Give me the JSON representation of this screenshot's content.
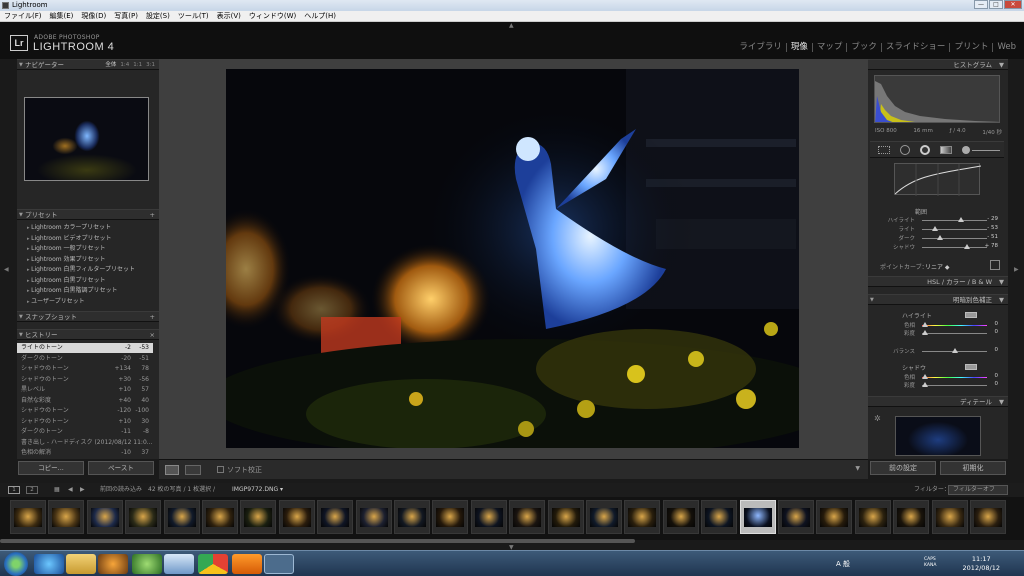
{
  "window": {
    "title": "Lightroom",
    "minimize": "—",
    "maximize": "□",
    "close": "✕"
  },
  "menu": [
    "ファイル(F)",
    "編集(E)",
    "現像(D)",
    "写真(P)",
    "設定(S)",
    "ツール(T)",
    "表示(V)",
    "ウィンドウ(W)",
    "ヘルプ(H)"
  ],
  "identity": {
    "logo": "Lr",
    "top": "ADOBE PHOTOSHOP",
    "name": "LIGHTROOM 4"
  },
  "modules": {
    "library": "ライブラリ",
    "develop": "現像",
    "map": "マップ",
    "book": "ブック",
    "slideshow": "スライドショー",
    "print": "プリント",
    "web": "Web",
    "active": "develop"
  },
  "navigator": {
    "title": "ナビゲーター",
    "opts": [
      "全体",
      "1:4",
      "1:1",
      "3:1"
    ]
  },
  "presets": {
    "title": "プリセット",
    "items": [
      "Lightroom カラープリセット",
      "Lightroom ビデオプリセット",
      "Lightroom 一般プリセット",
      "Lightroom 効果プリセット",
      "Lightroom 白黒フィルタープリセット",
      "Lightroom 白黒プリセット",
      "Lightroom 白黒階調プリセット",
      "ユーザープリセット"
    ]
  },
  "snapshots": {
    "title": "スナップショット"
  },
  "history": {
    "title": "ヒストリー",
    "close": "×",
    "rows": [
      {
        "name": "ライトのトーン",
        "a": "-2",
        "b": "-53"
      },
      {
        "name": "ダークのトーン",
        "a": "-20",
        "b": "-51"
      },
      {
        "name": "シャドウのトーン",
        "a": "+134",
        "b": "78"
      },
      {
        "name": "シャドウのトーン",
        "a": "+30",
        "b": "-56"
      },
      {
        "name": "黒レベル",
        "a": "+10",
        "b": "57"
      },
      {
        "name": "自然な彩度",
        "a": "+40",
        "b": "40"
      },
      {
        "name": "シャドウのトーン",
        "a": "-120",
        "b": "-100"
      },
      {
        "name": "シャドウのトーン",
        "a": "+10",
        "b": "30"
      },
      {
        "name": "ダークのトーン",
        "a": "-11",
        "b": "-8"
      },
      {
        "name": "書き出し - ハードディスク (2012/08/12 11:0...",
        "a": "",
        "b": ""
      },
      {
        "name": "色相の解消",
        "a": "-10",
        "b": "37"
      }
    ]
  },
  "left_buttons": {
    "copy": "コピー...",
    "paste": "ペースト"
  },
  "toolbar": {
    "softproof": "ソフト校正"
  },
  "right_panel": {
    "histogram_title": "ヒストグラム",
    "exif": {
      "iso": "ISO 800",
      "focal": "16 mm",
      "aperture": "ƒ / 4.0",
      "shutter": "1/40 秒"
    },
    "range_title": "範囲",
    "sliders": [
      {
        "label": "ハイライト",
        "value": "- 29"
      },
      {
        "label": "ライト",
        "value": "- 53"
      },
      {
        "label": "ダーク",
        "value": "- 51"
      },
      {
        "label": "シャドウ",
        "value": "+ 78"
      }
    ],
    "point_curve_label": "ポイントカーブ：",
    "point_curve_value": "リニア ◆",
    "hsl_tabs": "HSL / カラー / B & W",
    "split_title": "明暗別色補正",
    "highlights": "ハイライト",
    "hue": "色相",
    "saturation": "彩度",
    "balance": "バランス",
    "shadows": "シャドウ",
    "zero": "0",
    "detail_title": "ディテール",
    "prev_btn": "前の設定",
    "reset_btn": "初期化"
  },
  "filmstrip_bar": {
    "pages": [
      "1",
      "2"
    ],
    "source": "前回の読み込み",
    "count": "42 枚の写真 / 1 枚選択 /",
    "filename": "IMGP9772.DNG ▾",
    "filter_label": "フィルター：",
    "filter_value": "フィルターオフ"
  },
  "clock": {
    "time": "11:17",
    "date": "2012/08/12"
  },
  "tray": {
    "ime": "A 般",
    "caps": "CAPS\nKANA"
  }
}
